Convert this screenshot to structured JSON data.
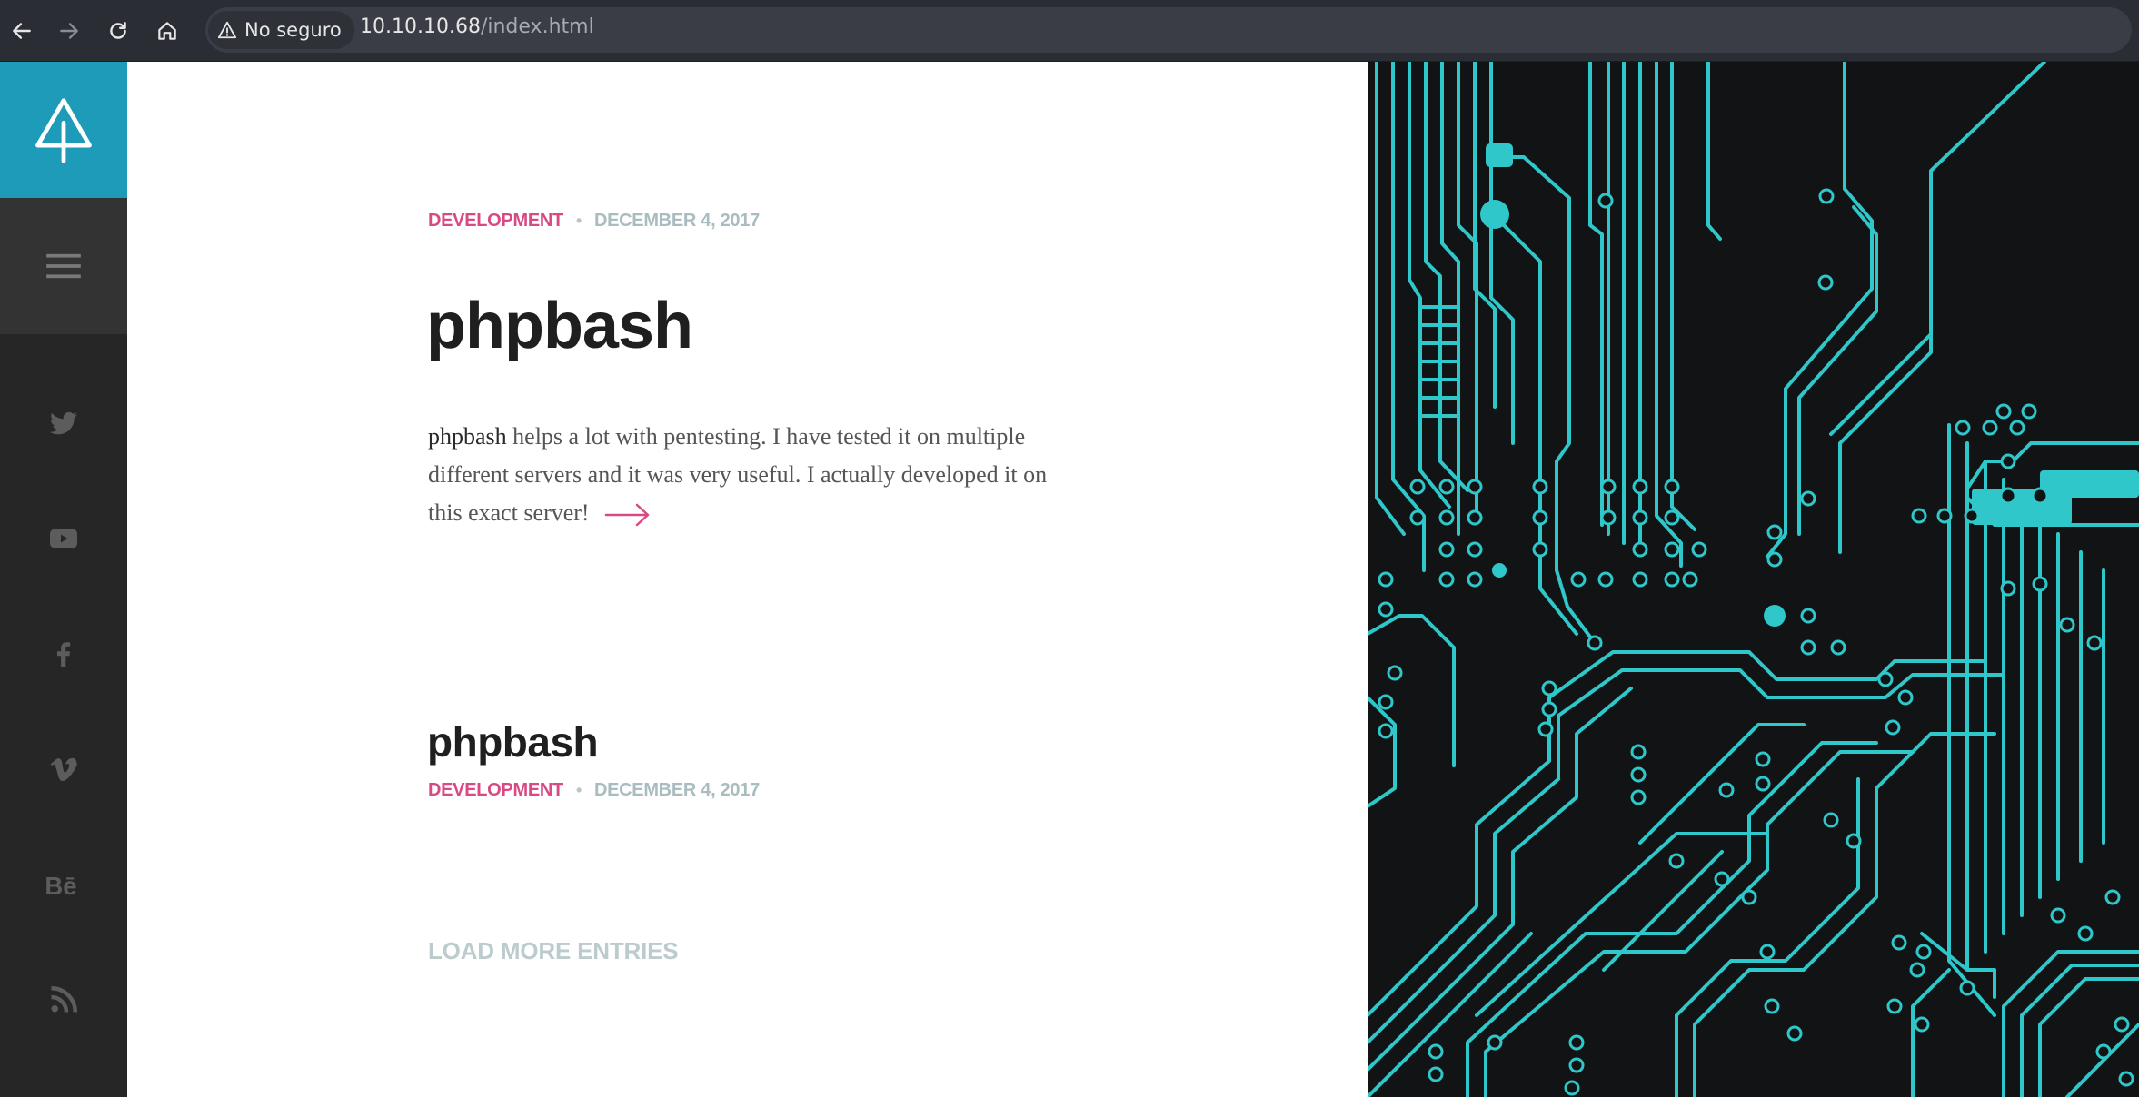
{
  "browser": {
    "security_label": "No seguro",
    "url_host": "10.10.10.68",
    "url_path": "/index.html"
  },
  "sidebar": {
    "social_icons": [
      "twitter-icon",
      "youtube-icon",
      "facebook-icon",
      "vimeo-icon",
      "behance-icon",
      "rss-icon"
    ]
  },
  "featured_post": {
    "category": "DEVELOPMENT",
    "separator": "•",
    "date": "DECEMBER 4, 2017",
    "title": "phpbash",
    "excerpt_lead": "phpbash",
    "excerpt_rest": " helps a lot with pentesting. I have tested it on multiple different servers and it was very useful. I actually developed it on this exact server!"
  },
  "post_list": [
    {
      "title": "phpbash",
      "category": "DEVELOPMENT",
      "separator": "•",
      "date": "DECEMBER 4, 2017"
    }
  ],
  "load_more_label": "LOAD MORE ENTRIES",
  "colors": {
    "accent_teal": "#1e9bb8",
    "category_pink": "#d94a84",
    "date_gray": "#a9bcbf",
    "circuit": "#2fc7c9"
  }
}
